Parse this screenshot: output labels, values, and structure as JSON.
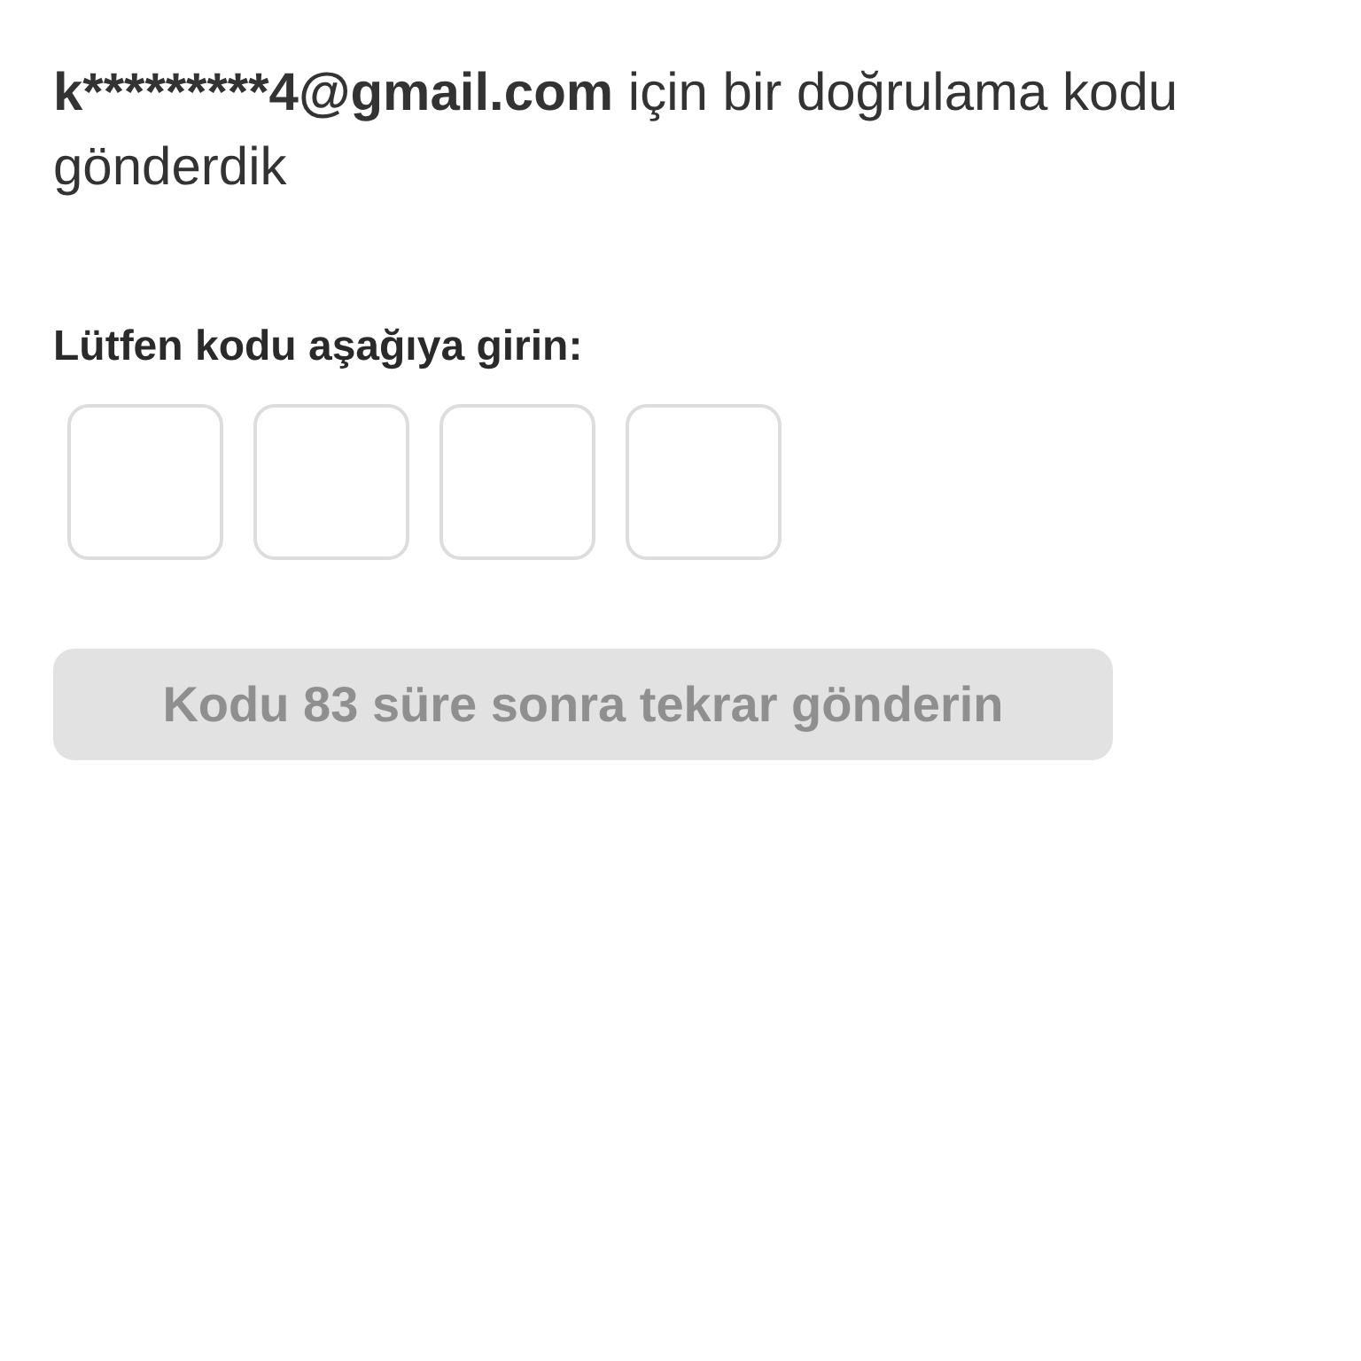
{
  "message": {
    "email": "k*********4@gmail.com",
    "text": "için bir doğrulama kodu gönderdik"
  },
  "code_label": "Lütfen kodu aşağıya girin:",
  "code_boxes": [
    {
      "kind": "digit"
    },
    {
      "kind": "digit"
    },
    {
      "kind": "digit"
    },
    {
      "kind": "digit"
    }
  ],
  "resend_button": {
    "label": "Kodu 83 süre sonra tekrar gönderin",
    "disabled": true
  }
}
